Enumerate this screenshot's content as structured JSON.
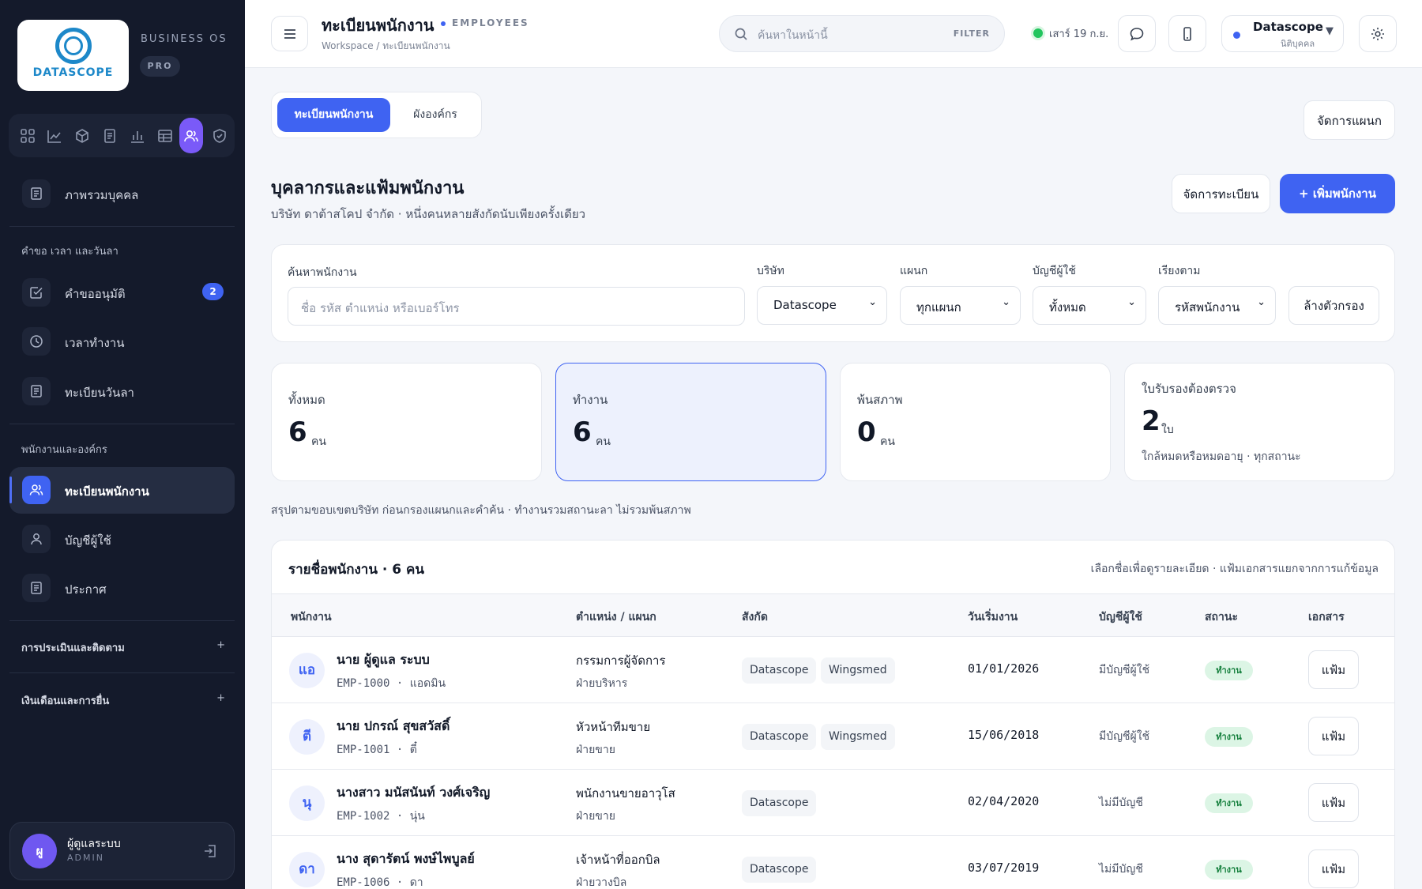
{
  "brand": {
    "logo_word": "DATASCOPE",
    "product": "BUSINESS OS",
    "tier": "PRO"
  },
  "rail_icons": [
    "grid-icon",
    "trend-icon",
    "box-icon",
    "document-icon",
    "bar-chart-icon",
    "table-icon",
    "users-icon",
    "shield-icon"
  ],
  "sidebar": {
    "overview": "ภาพรวมบุคคล",
    "section_time": "คำขอ เวลา และวันลา",
    "approvals": "คำขออนุมัติ",
    "approvals_badge": "2",
    "work_time": "เวลาทำงาน",
    "leave_register": "ทะเบียนวันลา",
    "section_org": "พนักงานและองค์กร",
    "employee_register": "ทะเบียนพนักงาน",
    "user_accounts": "บัญชีผู้ใช้",
    "announcements": "ประกาศ",
    "group_eval": "การประเมินและติดตาม",
    "group_payroll": "เงินเดือนและการยื่น",
    "group_plus": "+"
  },
  "user": {
    "initial": "ผู",
    "name": "ผู้ดูแลระบบ",
    "role": "ADMIN"
  },
  "topbar": {
    "title": "ทะเบียนพนักงาน",
    "subtitle": "EMPLOYEES",
    "breadcrumb": "Workspace / ทะเบียนพนักงาน",
    "search_placeholder": "ค้นหาในหน้านี้",
    "filter_label": "FILTER",
    "date": "เสาร์ 19 ก.ย.",
    "company_name": "Datascope",
    "company_type": "นิติบุคคล",
    "caret": "▼"
  },
  "tabs": {
    "active": "ทะเบียนพนักงาน",
    "other": "ผังองค์กร"
  },
  "actions": {
    "manage_departments": "จัดการแผนก",
    "manage_register": "จัดการทะเบียน",
    "add_employee": "+ เพิ่มพนักงาน"
  },
  "section": {
    "title": "บุคลากรและแฟ้มพนักงาน",
    "subtitle": "บริษัท ดาต้าสโคป จำกัด · หนึ่งคนหลายสังกัดนับเพียงครั้งเดียว"
  },
  "filters": {
    "search_label": "ค้นหาพนักงาน",
    "search_placeholder": "ชื่อ รหัส ตำแหน่ง หรือเบอร์โทร",
    "company_label": "บริษัท",
    "company_value": "Datascope",
    "department_label": "แผนก",
    "department_value": "ทุกแผนก",
    "account_label": "บัญชีผู้ใช้",
    "account_value": "ทั้งหมด",
    "sort_label": "เรียงตาม",
    "sort_value": "รหัสพนักงาน",
    "clear": "ล้างตัวกรอง",
    "chevron": "⌄"
  },
  "stats": [
    {
      "label": "ทั้งหมด",
      "value": "6",
      "unit": "คน"
    },
    {
      "label": "ทำงาน",
      "value": "6",
      "unit": "คน"
    },
    {
      "label": "พ้นสภาพ",
      "value": "0",
      "unit": "คน"
    },
    {
      "label": "ใบรับรองต้องตรวจ",
      "value": "2",
      "unit": "ใบ",
      "note": "ใกล้หมดหรือหมดอายุ · ทุกสถานะ"
    }
  ],
  "summary_note": "สรุปตามขอบเขตบริษัท ก่อนกรองแผนกและคำค้น · ทำงานรวมสถานะลา ไม่รวมพ้นสภาพ",
  "table": {
    "title": "รายชื่อพนักงาน · 6 คน",
    "hint": "เลือกชื่อเพื่อดูรายละเอียด · แฟ้มเอกสารแยกจากการแก้ข้อมูล",
    "headers": {
      "employee": "พนักงาน",
      "position": "ตำแหน่ง / แผนก",
      "affiliation": "สังกัด",
      "start_date": "วันเริ่มงาน",
      "account": "บัญชีผู้ใช้",
      "status": "สถานะ",
      "documents": "เอกสาร"
    },
    "rows": [
      {
        "initial": "แอ",
        "name": "นาย ผู้ดูแล ระบบ",
        "id": "EMP-1000 · แอดมิน",
        "position": "กรรมการผู้จัดการ",
        "dept": "ฝ่ายบริหาร",
        "aff1": "Datascope",
        "aff2": "Wingsmed",
        "start": "01/01/2026",
        "account": "มีบัญชีผู้ใช้",
        "status": "ทำงาน",
        "doc": "แฟ้ม"
      },
      {
        "initial": "ตี",
        "name": "นาย ปกรณ์ สุขสวัสดิ์",
        "id": "EMP-1001 · ตี๋",
        "position": "หัวหน้าทีมขาย",
        "dept": "ฝ่ายขาย",
        "aff1": "Datascope",
        "aff2": "Wingsmed",
        "start": "15/06/2018",
        "account": "มีบัญชีผู้ใช้",
        "status": "ทำงาน",
        "doc": "แฟ้ม"
      },
      {
        "initial": "นุ",
        "name": "นางสาว มนัสนันท์ วงศ์เจริญ",
        "id": "EMP-1002 · นุ่น",
        "position": "พนักงานขายอาวุโส",
        "dept": "ฝ่ายขาย",
        "aff1": "Datascope",
        "start": "02/04/2020",
        "account": "ไม่มีบัญชี",
        "status": "ทำงาน",
        "doc": "แฟ้ม"
      },
      {
        "initial": "ดา",
        "name": "นาง สุดารัตน์ พงษ์ไพบูลย์",
        "id": "EMP-1006 · ดา",
        "position": "เจ้าหน้าที่ออกบิล",
        "dept": "ฝ่ายวางบิล",
        "aff1": "Datascope",
        "start": "03/07/2019",
        "account": "ไม่มีบัญชี",
        "status": "ทำงาน",
        "doc": "แฟ้ม"
      }
    ]
  }
}
